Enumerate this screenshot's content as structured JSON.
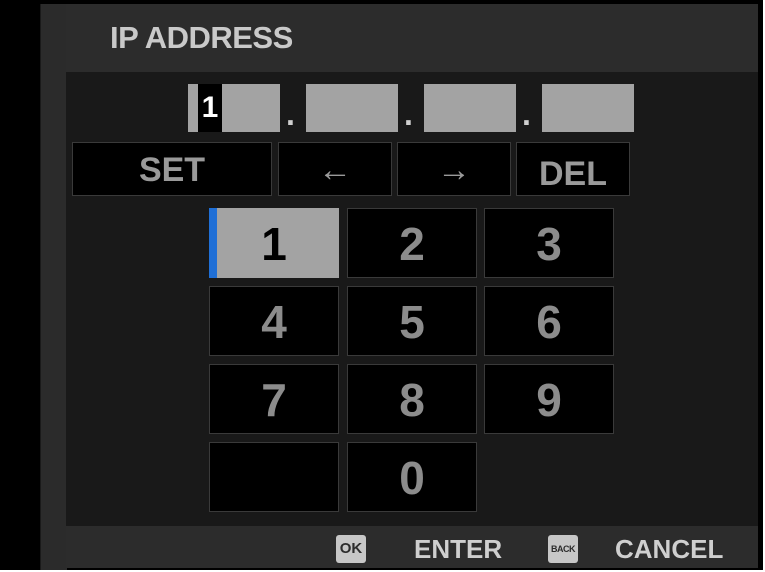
{
  "header": {
    "title": "IP ADDRESS"
  },
  "ip_fields": {
    "octet1": "1",
    "separator": "."
  },
  "commands": {
    "set": "SET",
    "left": "←",
    "right": "→",
    "del": "DEL"
  },
  "keypad": {
    "keys": [
      "1",
      "2",
      "3",
      "4",
      "5",
      "6",
      "7",
      "8",
      "9",
      "",
      "0"
    ],
    "selected": "1"
  },
  "footer": {
    "ok_icon": "OK",
    "enter_label": "ENTER",
    "back_icon": "BACK",
    "cancel_label": "CANCEL"
  },
  "colors": {
    "accent": "#1f6fd6",
    "selected_fill": "#a3a3a3",
    "panel": "#2c2c2c",
    "background": "#191919"
  }
}
